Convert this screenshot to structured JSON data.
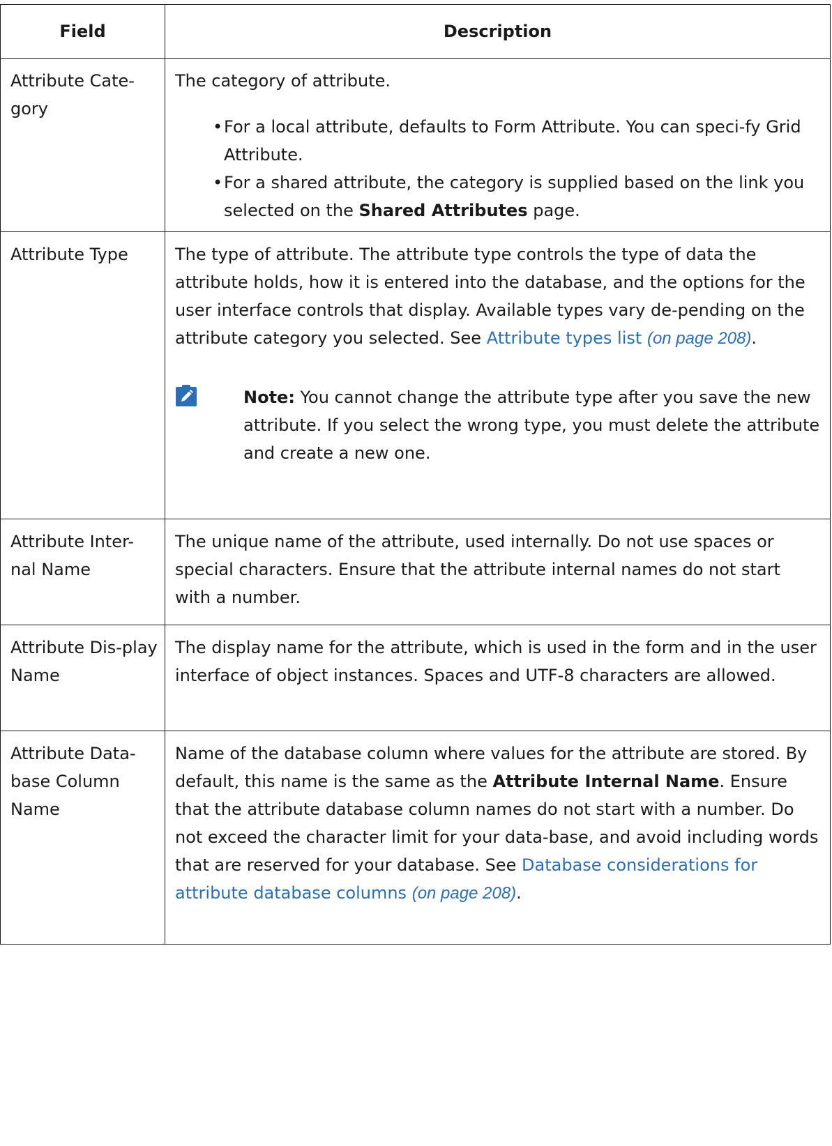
{
  "table": {
    "headers": {
      "field": "Field",
      "description": "Description"
    },
    "rows": [
      {
        "field": "Attribute Cate-gory",
        "desc_intro": "The category of attribute.",
        "bullets": [
          {
            "text": "For a local attribute, defaults to Form Attribute. You can speci-fy Grid Attribute."
          },
          {
            "text_before": "For a shared attribute, the category is supplied based on the link you selected on the ",
            "bold": "Shared Attributes",
            "text_after": " page."
          }
        ]
      },
      {
        "field": "Attribute Type",
        "desc_text": "The type of attribute. The attribute type controls the type of data the attribute holds, how it is entered into the database, and the options for the user interface controls that display. Available types vary de-pending on the attribute category you selected. See ",
        "link_text": "Attribute types list",
        "link_page": "(on page 208)",
        "desc_end": ".",
        "note": {
          "icon": "pencil-note-icon",
          "label": "Note:",
          "text": " You cannot change the attribute type after you save the new attribute. If you select the wrong type, you must delete the attribute and create a new one."
        }
      },
      {
        "field": "Attribute Inter-nal Name",
        "desc_text": "The unique name of the attribute, used internally. Do not use spaces or special characters. Ensure that the attribute internal names do not start with a number."
      },
      {
        "field": "Attribute Dis-play Name",
        "desc_text": "The display name for the attribute, which is used in the form and in the user interface of object instances. Spaces and UTF-8 characters are allowed."
      },
      {
        "field": "Attribute Data-base Column Name",
        "desc_before": "Name of the database column where values for the attribute are stored. By default, this name is the same as the ",
        "desc_bold": "Attribute Internal Name",
        "desc_after": ". Ensure that the attribute database column names do not start with a number. Do not exceed the character limit for your data-base, and avoid including words that are reserved for your database. See ",
        "link_text": "Database considerations for attribute database columns",
        "link_page": "(on page 208)",
        "desc_end": "."
      }
    ]
  },
  "colors": {
    "link": "#2a6fb5",
    "note_icon": "#2a6fb5",
    "border": "#1a1a1a"
  }
}
